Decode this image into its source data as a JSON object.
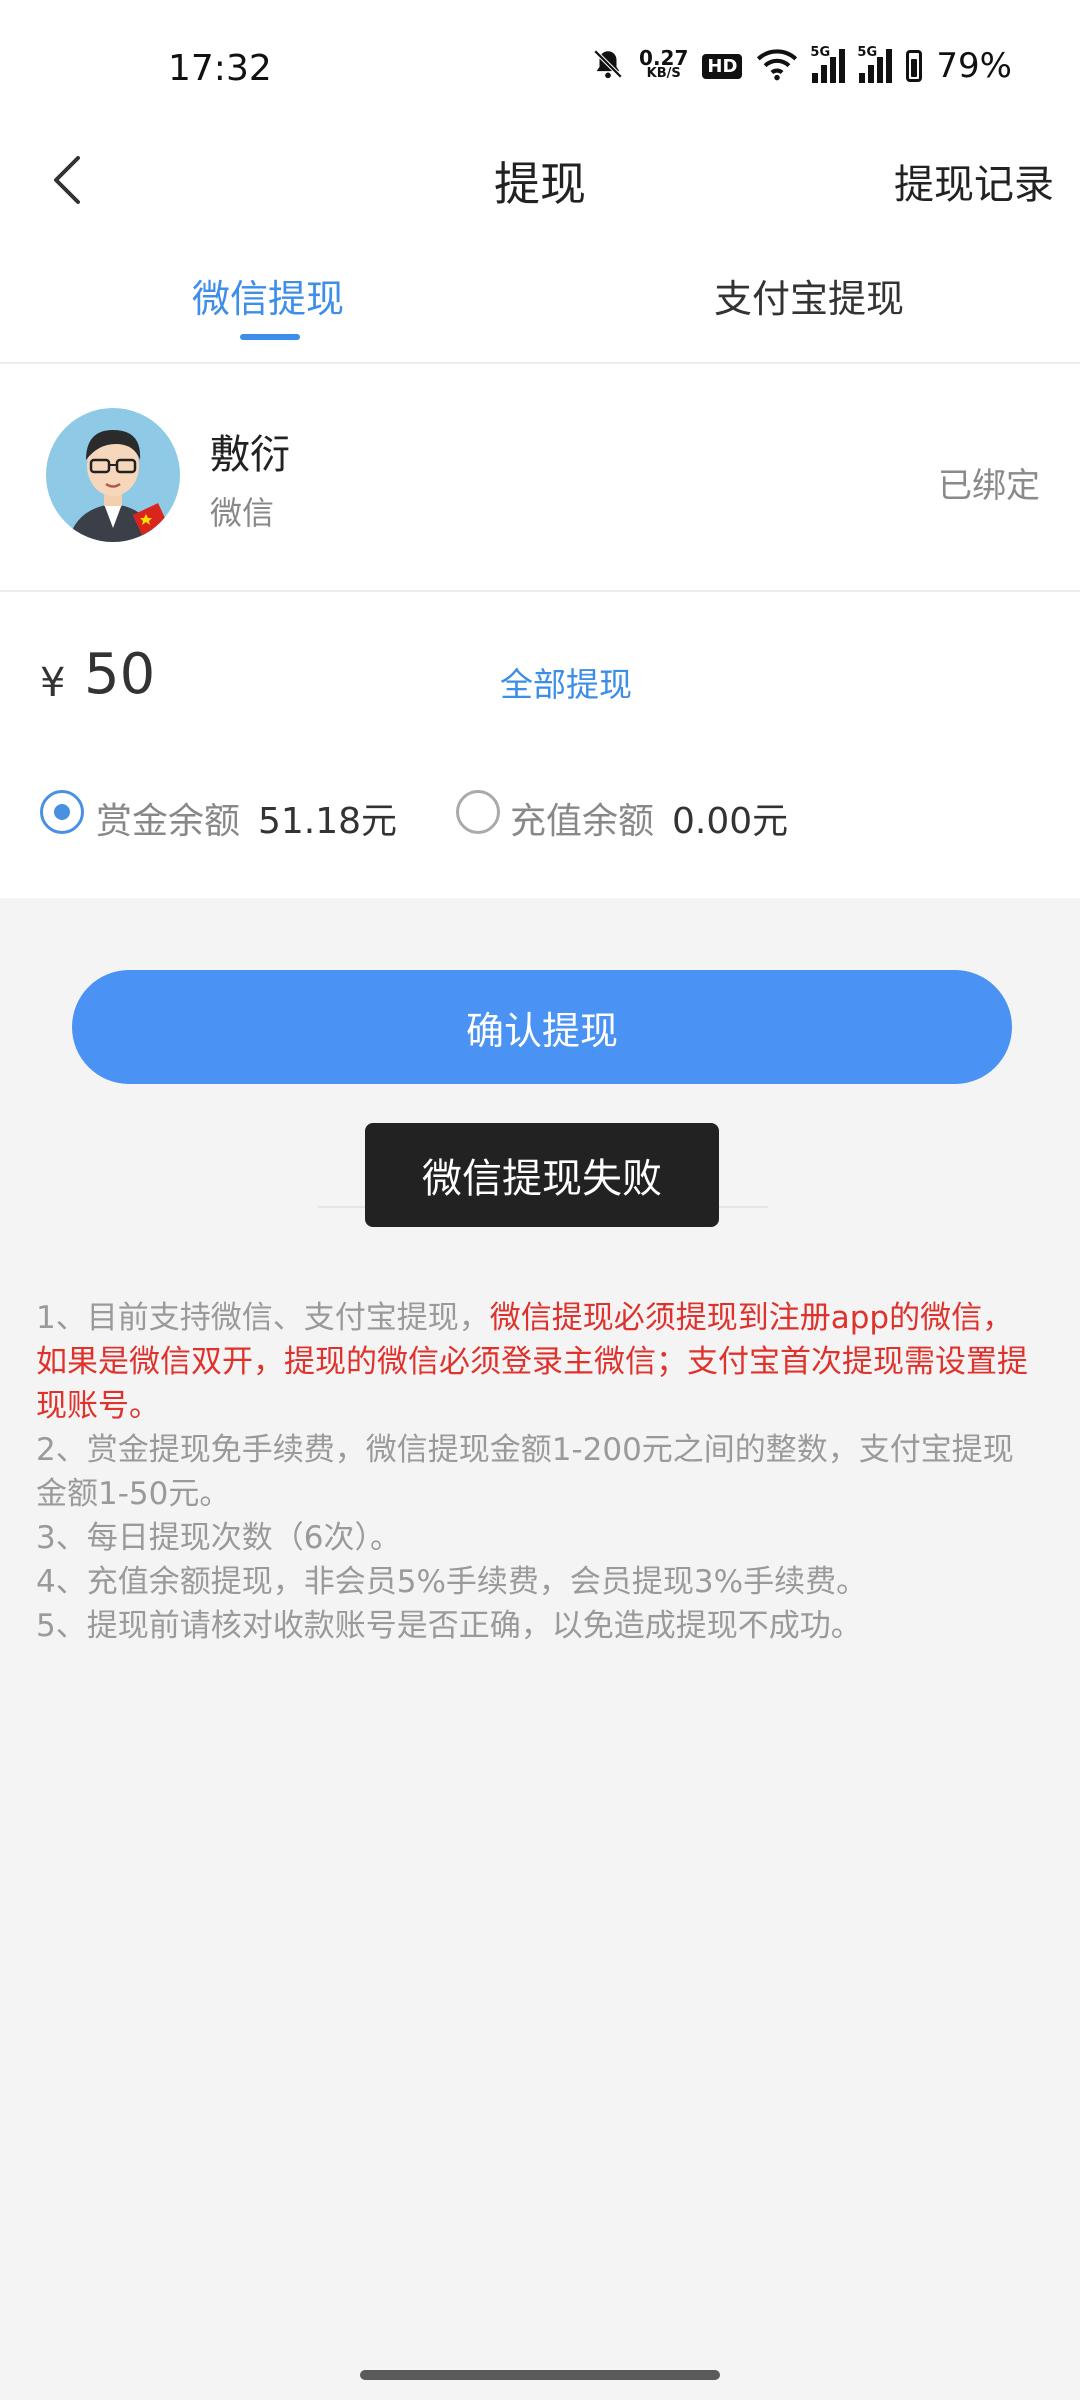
{
  "status_bar": {
    "time": "17:32",
    "net_speed_value": "0.27",
    "net_speed_unit": "KB/S",
    "hd_label": "HD",
    "signal1_label": "5G",
    "signal2_label": "5G",
    "battery_percent": "79%"
  },
  "header": {
    "title": "提现",
    "record_label": "提现记录"
  },
  "tabs": [
    {
      "label": "微信提现",
      "active": true
    },
    {
      "label": "支付宝提现",
      "active": false
    }
  ],
  "account": {
    "name": "敷衍",
    "type": "微信",
    "status": "已绑定"
  },
  "amount": {
    "currency": "¥",
    "value": "50",
    "withdraw_all_label": "全部提现"
  },
  "balances": [
    {
      "label": "赏金余额",
      "value": "51.18元",
      "selected": true
    },
    {
      "label": "充值余额",
      "value": "0.00元",
      "selected": false
    }
  ],
  "confirm_label": "确认提现",
  "toast": "微信提现失败",
  "notes": {
    "n1_prefix": "1、目前支持微信、支付宝提现，",
    "n1_red": "微信提现必须提现到注册app的微信，如果是微信双开，提现的微信必须登录主微信；支付宝首次提现需设置提现账号。",
    "n2": "2、赏金提现免手续费，微信提现金额1-200元之间的整数，支付宝提现金额1-50元。",
    "n3": "3、每日提现次数（6次）。",
    "n4": "4、充值余额提现，非会员5%手续费，会员提现3%手续费。",
    "n5": "5、提现前请核对收款账号是否正确，以免造成提现不成功。"
  },
  "colors": {
    "accent": "#3d8ee8",
    "button": "#4a93f5",
    "warning_red": "#e0322c",
    "toast_bg": "#222222"
  },
  "icons": [
    "back-arrow-icon",
    "mute-bell-icon",
    "wifi-icon",
    "signal-icon",
    "battery-icon"
  ]
}
